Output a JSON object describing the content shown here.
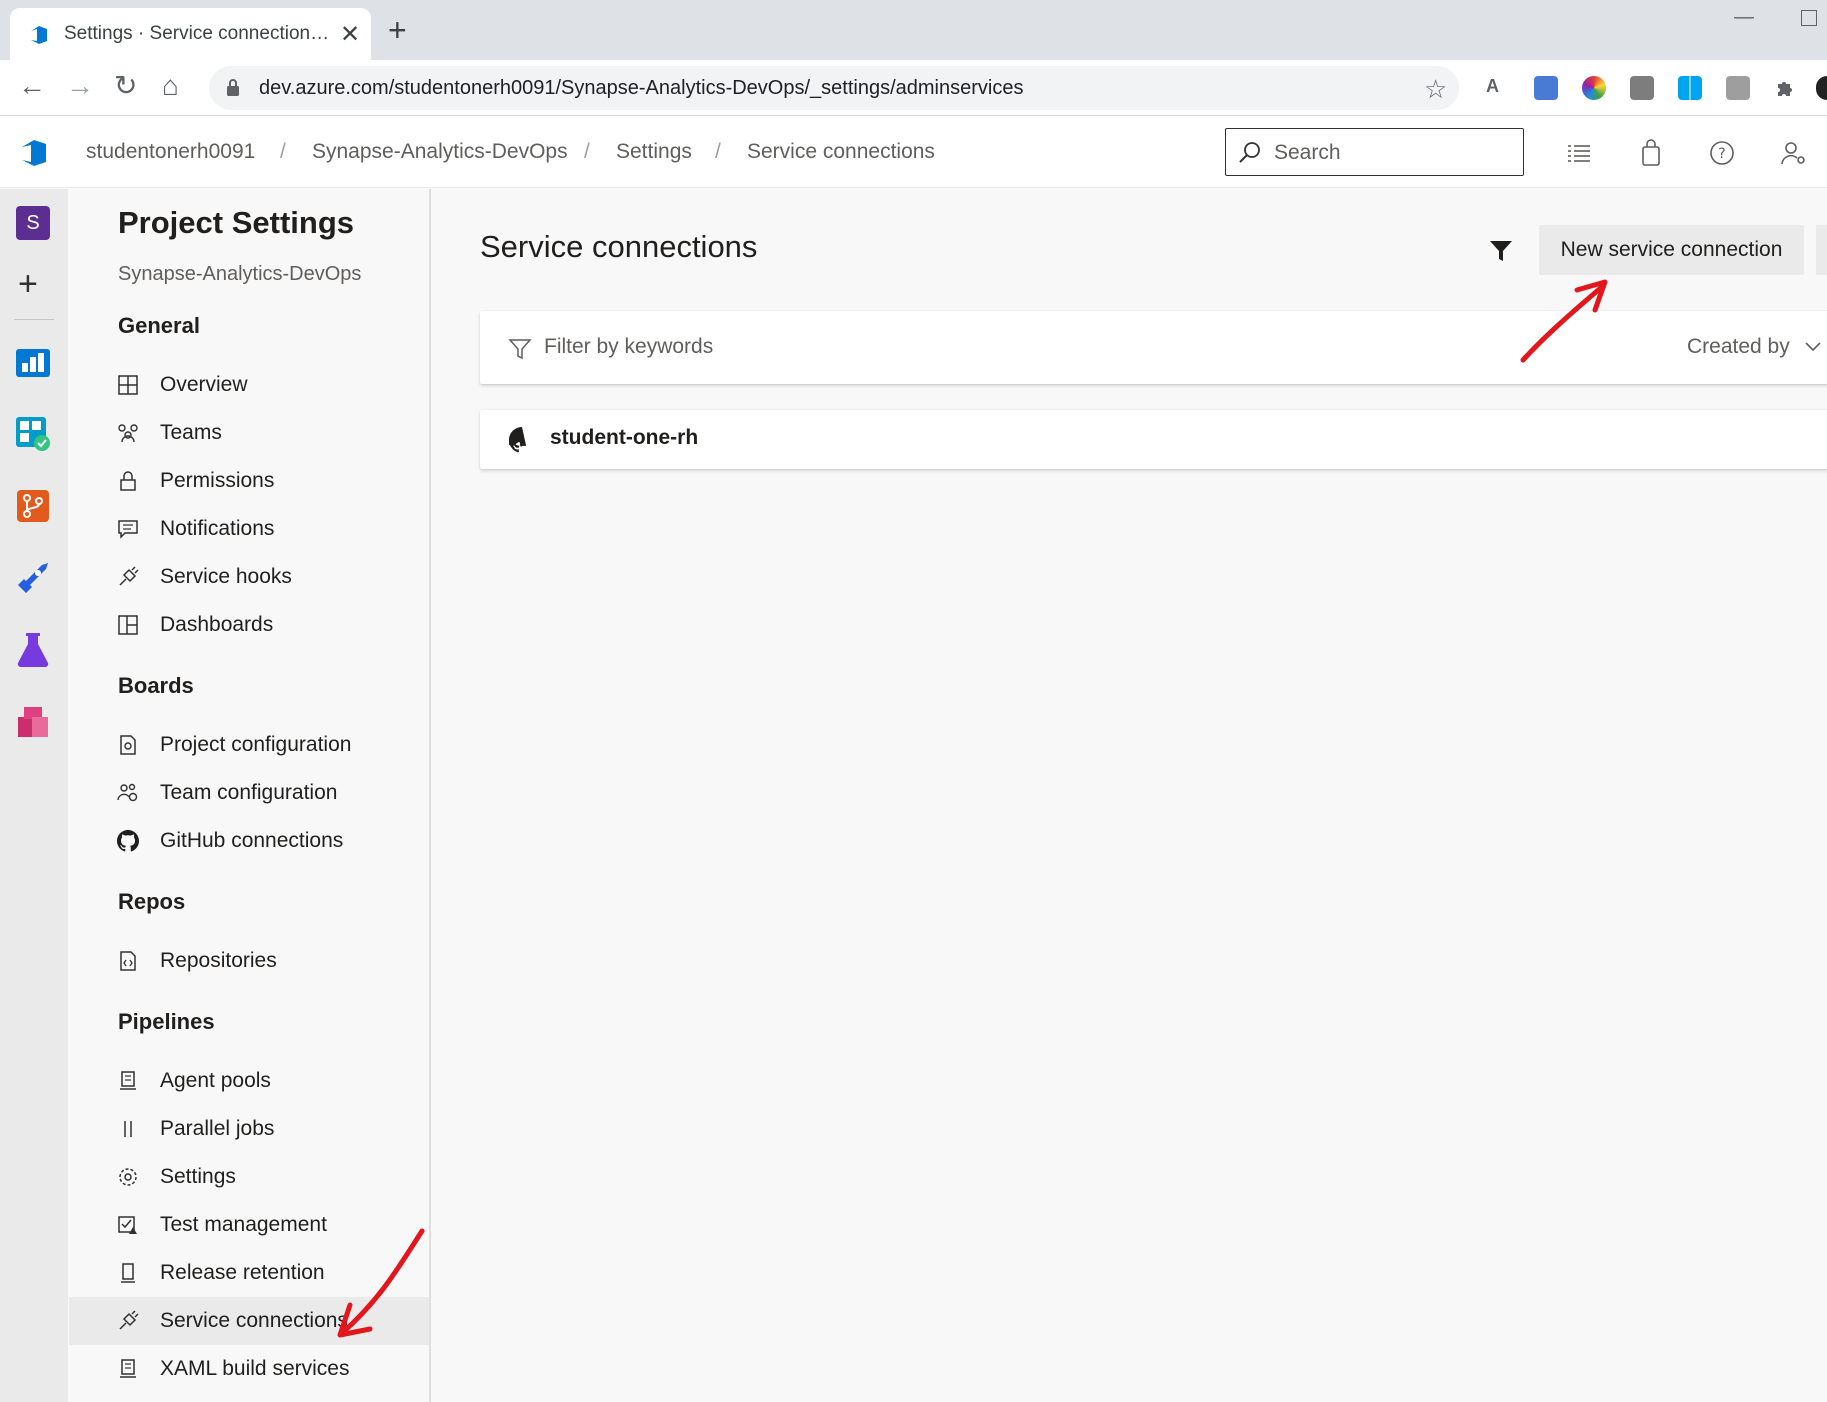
{
  "browser": {
    "tab_title": "Settings · Service connections (Synapse-Analytics-DevOps)",
    "tab_close": "✕",
    "new_tab": "+",
    "url": "dev.azure.com/studentonerh0091/Synapse-Analytics-DevOps/_settings/adminservices",
    "back": "←",
    "forward": "→",
    "reload": "↻",
    "home": "⌂",
    "bookmark": "☆",
    "minimize": "—"
  },
  "header": {
    "breadcrumbs": [
      "studentonerh0091",
      "Synapse-Analytics-DevOps",
      "Settings",
      "Service connections"
    ],
    "separator": "/",
    "search_placeholder": "Search"
  },
  "rail": {
    "avatar_letter": "S",
    "add": "+"
  },
  "sidebar": {
    "title": "Project Settings",
    "subtitle": "Synapse-Analytics-DevOps",
    "sections": [
      {
        "heading": "General",
        "items": [
          {
            "label": "Overview",
            "icon": "overview-icon"
          },
          {
            "label": "Teams",
            "icon": "teams-icon"
          },
          {
            "label": "Permissions",
            "icon": "lock-icon"
          },
          {
            "label": "Notifications",
            "icon": "notification-icon"
          },
          {
            "label": "Service hooks",
            "icon": "plug-icon"
          },
          {
            "label": "Dashboards",
            "icon": "dashboard-icon"
          }
        ]
      },
      {
        "heading": "Boards",
        "items": [
          {
            "label": "Project configuration",
            "icon": "document-gear-icon"
          },
          {
            "label": "Team configuration",
            "icon": "team-gear-icon"
          },
          {
            "label": "GitHub connections",
            "icon": "github-icon"
          }
        ]
      },
      {
        "heading": "Repos",
        "items": [
          {
            "label": "Repositories",
            "icon": "code-file-icon"
          }
        ]
      },
      {
        "heading": "Pipelines",
        "items": [
          {
            "label": "Agent pools",
            "icon": "agent-icon"
          },
          {
            "label": "Parallel jobs",
            "icon": "parallel-icon"
          },
          {
            "label": "Settings",
            "icon": "gear-icon"
          },
          {
            "label": "Test management",
            "icon": "test-icon"
          },
          {
            "label": "Release retention",
            "icon": "retention-icon"
          },
          {
            "label": "Service connections",
            "icon": "plug-icon",
            "selected": true
          },
          {
            "label": "XAML build services",
            "icon": "agent-icon"
          }
        ]
      }
    ]
  },
  "main": {
    "title": "Service connections",
    "new_button": "New service connection",
    "filter_placeholder": "Filter by keywords",
    "created_by": "Created by",
    "connections": [
      {
        "name": "student-one-rh",
        "icon": "github-icon"
      }
    ]
  },
  "colors": {
    "ado_blue": "#0078d4",
    "annotation_red": "#e3161c",
    "selected_bg": "#eaeaea"
  }
}
